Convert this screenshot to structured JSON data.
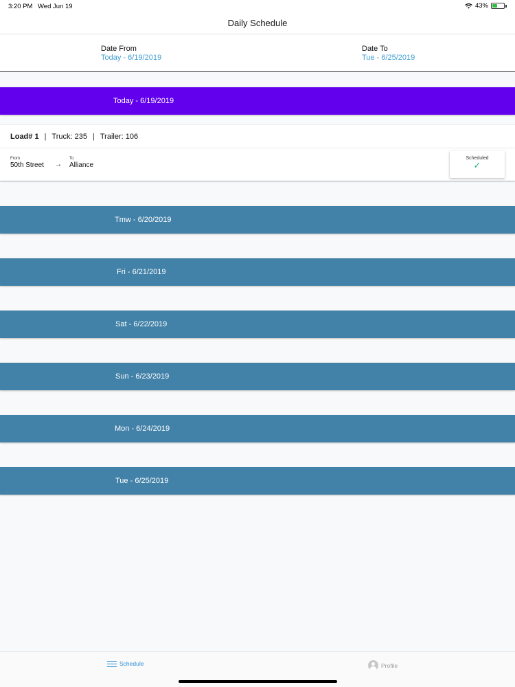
{
  "status_bar": {
    "time": "3:20 PM",
    "date": "Wed Jun 19",
    "battery": "43%"
  },
  "nav": {
    "title": "Daily Schedule"
  },
  "date_range": {
    "from_label": "Date From",
    "from_value": "Today - 6/19/2019",
    "to_label": "Date To",
    "to_value": "Tue - 6/25/2019"
  },
  "days": [
    {
      "label": "Today - 6/19/2019"
    },
    {
      "label": "Tmw - 6/20/2019"
    },
    {
      "label": "Fri - 6/21/2019"
    },
    {
      "label": "Sat - 6/22/2019"
    },
    {
      "label": "Sun - 6/23/2019"
    },
    {
      "label": "Mon - 6/24/2019"
    },
    {
      "label": "Tue - 6/25/2019"
    }
  ],
  "load": {
    "load_label": "Load# 1",
    "sep": "|",
    "truck": "Truck: 235",
    "trailer": "Trailer: 106",
    "from_small": "From",
    "from_place": "50th Street",
    "to_small": "To",
    "to_place": "Alliance",
    "arrow": "→",
    "status": "Scheduled",
    "status_icon": "✓"
  },
  "tabs": {
    "schedule": "Schedule",
    "profile": "Profile"
  },
  "colors": {
    "today_header": "#6200ee",
    "day_header": "#4281a8",
    "accent": "#3f9dd0",
    "check": "#21b27b"
  }
}
